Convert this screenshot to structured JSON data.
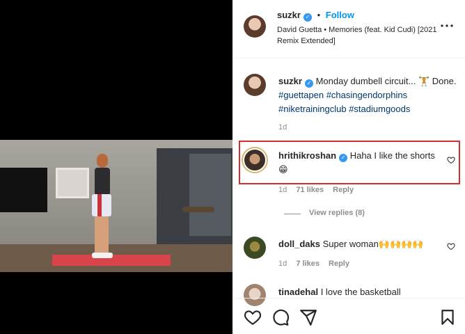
{
  "post": {
    "username": "suzkr",
    "dot": "•",
    "follow_label": "Follow",
    "music": "David Guetta • Memories (feat. Kid Cudi) [2021 Remix Extended]",
    "more_icon": "more-horizontal-icon"
  },
  "caption": {
    "username": "suzkr",
    "text_plain": "Monday dumbell circuit... 🏋️ Done.",
    "hashtags": [
      "#guettapen",
      "#chasingendorphins",
      "#niketrainingclub",
      "#stadiumgoods"
    ],
    "age": "1d"
  },
  "comments": [
    {
      "username": "hrithikroshan",
      "verified": true,
      "text": "Haha I like the shorts 😁",
      "age": "1d",
      "likes": "71 likes",
      "reply_label": "Reply",
      "view_replies": "View replies (8)"
    },
    {
      "username": "doll_daks",
      "verified": false,
      "text": "Super woman🙌🙌🙌🙌",
      "age": "1d",
      "likes": "7 likes",
      "reply_label": "Reply"
    },
    {
      "username": "tinadehal",
      "verified": false,
      "text": "I love the basketball"
    }
  ],
  "actions": [
    "heart-icon",
    "comment-icon",
    "share-icon",
    "bookmark-icon"
  ],
  "colors": {
    "accent": "#0095f6",
    "verified": "#3897f0",
    "highlight": "#d32f2f"
  }
}
